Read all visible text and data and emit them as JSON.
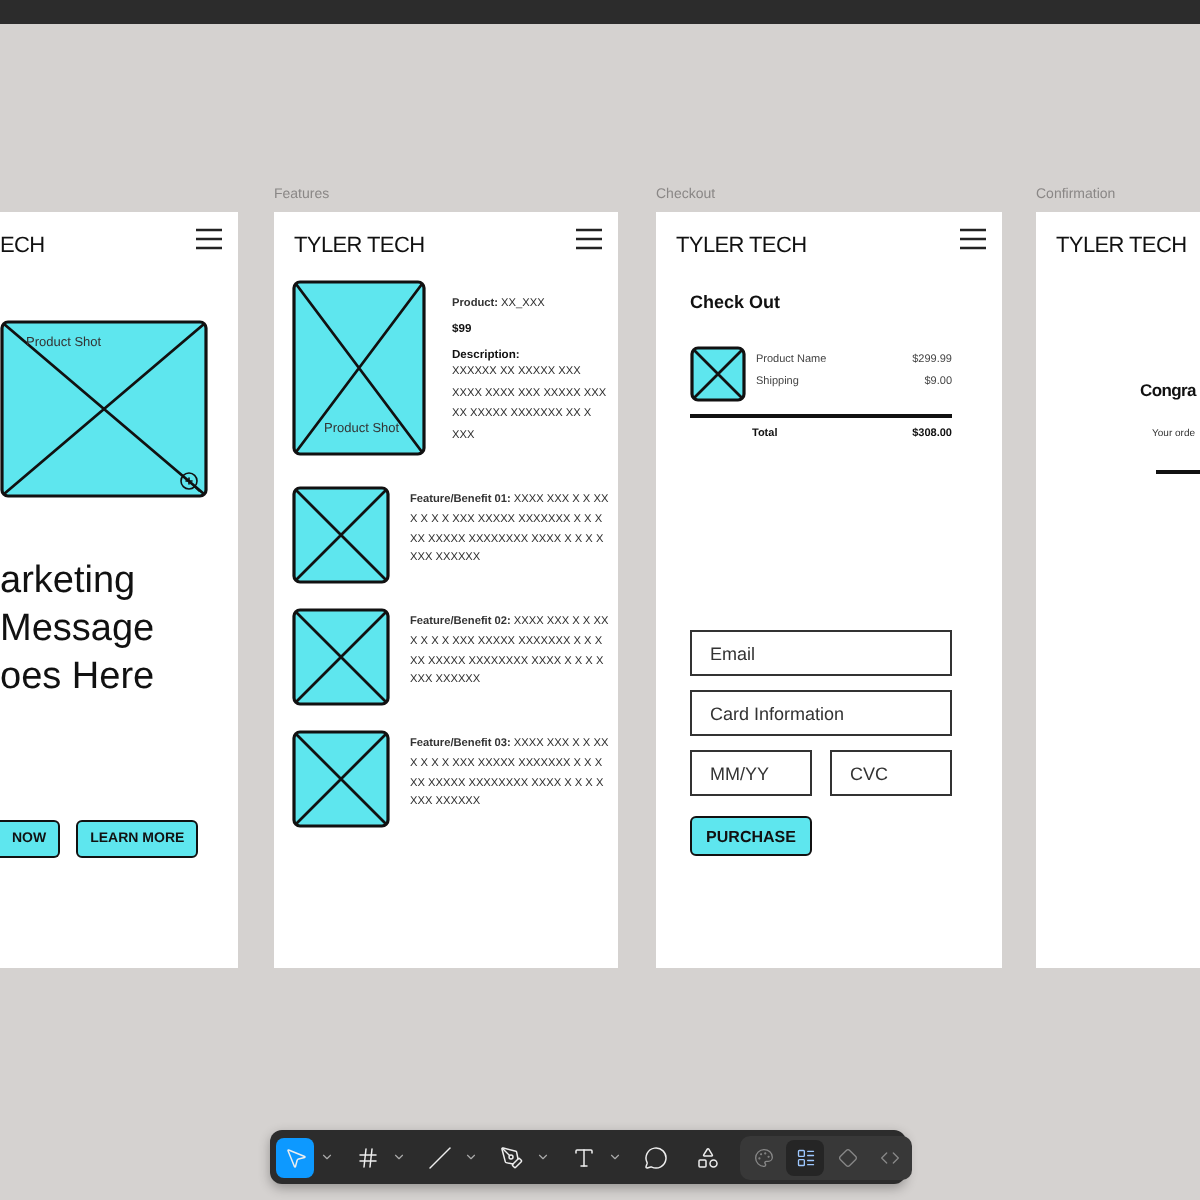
{
  "canvas": {
    "frames": [
      {
        "kind": "landing",
        "brand": "ECH",
        "image_caption": "Product Shot",
        "headline": [
          "arketing",
          "Message",
          "oes Here"
        ],
        "buttons": [
          "NOW",
          "LEARN MORE"
        ]
      },
      {
        "kind": "features",
        "label": "Features",
        "brand": "TYLER TECH",
        "image_caption": "Product Shot",
        "product": "**Product:** XX_XXX",
        "price": "$99",
        "description_label": "Description:",
        "description": "XXXXXX XX XXXXX XXX XXXX XXXX  XXX XXXXX XXX XX XXXXX XXXXXXX XX X XXX",
        "features": [
          "**Feature/Benefit 01:** XXXX XXX X X XX X X X X XXX XXXXX XXXXXXX X X X XX XXXXX XXXXXXXX XXXX X X X X XXX XXXXXX",
          "**Feature/Benefit 02:** XXXX XXX X X XX X X X X XXX XXXXX XXXXXXX X X X XX XXXXX XXXXXXXX XXXX X X X X XXX XXXXXX",
          "**Feature/Benefit 03:** XXXX XXX X X XX X X X X XXX XXXXX XXXXXXX X X X XX XXXXX XXXXXXXX XXXX X X X X XXX XXXXXX"
        ]
      },
      {
        "kind": "checkout",
        "label": "Checkout",
        "brand": "TYLER TECH",
        "heading": "Check Out",
        "lines": [
          {
            "name": "Product Name",
            "amount": "$299.99"
          },
          {
            "name": "Shipping",
            "amount": "$9.00"
          }
        ],
        "total": {
          "label": "Total",
          "amount": "$308.00"
        },
        "fields": [
          {
            "placeholder": "Email"
          },
          {
            "placeholder": "Card Information"
          },
          {
            "placeholder": "MM/YY"
          },
          {
            "placeholder": "CVC"
          }
        ],
        "button": "PURCHASE"
      },
      {
        "kind": "confirmation",
        "label": "Confirmation",
        "brand": "TYLER TECH",
        "heading": "Congra",
        "message": "Your orde"
      }
    ]
  },
  "toolbar": {
    "tools": [
      {
        "kind": "move",
        "selected": true
      },
      {
        "kind": "frame",
        "selected": false
      },
      {
        "kind": "line",
        "selected": false
      },
      {
        "kind": "pen",
        "selected": false
      },
      {
        "kind": "text",
        "selected": false
      },
      {
        "kind": "comment",
        "selected": false
      },
      {
        "kind": "components",
        "selected": false
      }
    ],
    "modes": [
      {
        "kind": "draw",
        "selected": false
      },
      {
        "kind": "design",
        "selected": true
      },
      {
        "kind": "prototype",
        "selected": false
      },
      {
        "kind": "code",
        "selected": false
      }
    ]
  }
}
